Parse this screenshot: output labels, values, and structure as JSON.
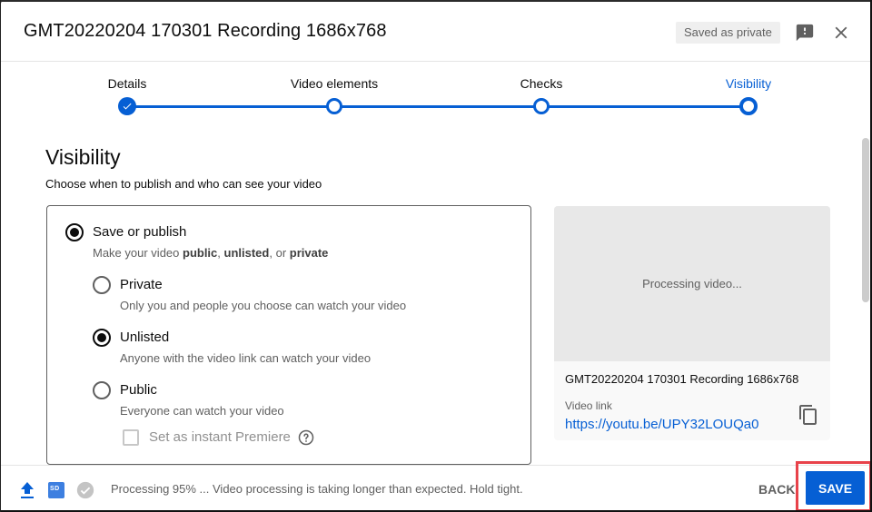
{
  "header": {
    "title": "GMT20220204 170301 Recording 1686x768",
    "saved_badge": "Saved as private",
    "feedback_icon": "feedback-icon",
    "close_icon": "close-icon"
  },
  "stepper": {
    "steps": [
      {
        "label": "Details",
        "state": "done"
      },
      {
        "label": "Video elements",
        "state": "pending"
      },
      {
        "label": "Checks",
        "state": "pending"
      },
      {
        "label": "Visibility",
        "state": "current"
      }
    ]
  },
  "visibility": {
    "title": "Visibility",
    "subtitle": "Choose when to publish and who can see your video",
    "save_publish": {
      "label": "Save or publish",
      "desc_prefix": "Make your video ",
      "desc_public": "public",
      "desc_sep1": ", ",
      "desc_unlisted": "unlisted",
      "desc_sep2": ", or ",
      "desc_private": "private",
      "checked": true
    },
    "options": [
      {
        "label": "Private",
        "desc": "Only you and people you choose can watch your video",
        "checked": false
      },
      {
        "label": "Unlisted",
        "desc": "Anyone with the video link can watch your video",
        "checked": true
      },
      {
        "label": "Public",
        "desc": "Everyone can watch your video",
        "checked": false
      }
    ],
    "premiere": {
      "label": "Set as instant Premiere",
      "checked": false,
      "disabled": true
    }
  },
  "preview": {
    "processing": "Processing video...",
    "filename": "GMT20220204 170301 Recording 1686x768",
    "link_label": "Video link",
    "link": "https://youtu.be/UPY32LOUQa0"
  },
  "footer": {
    "sd_badge": "SD",
    "status": "Processing 95% ... Video processing is taking longer than expected. Hold tight.",
    "progress_percent": 95,
    "back_label": "BACK",
    "save_label": "SAVE"
  },
  "colors": {
    "accent": "#065fd4",
    "highlight": "#e8424a"
  }
}
